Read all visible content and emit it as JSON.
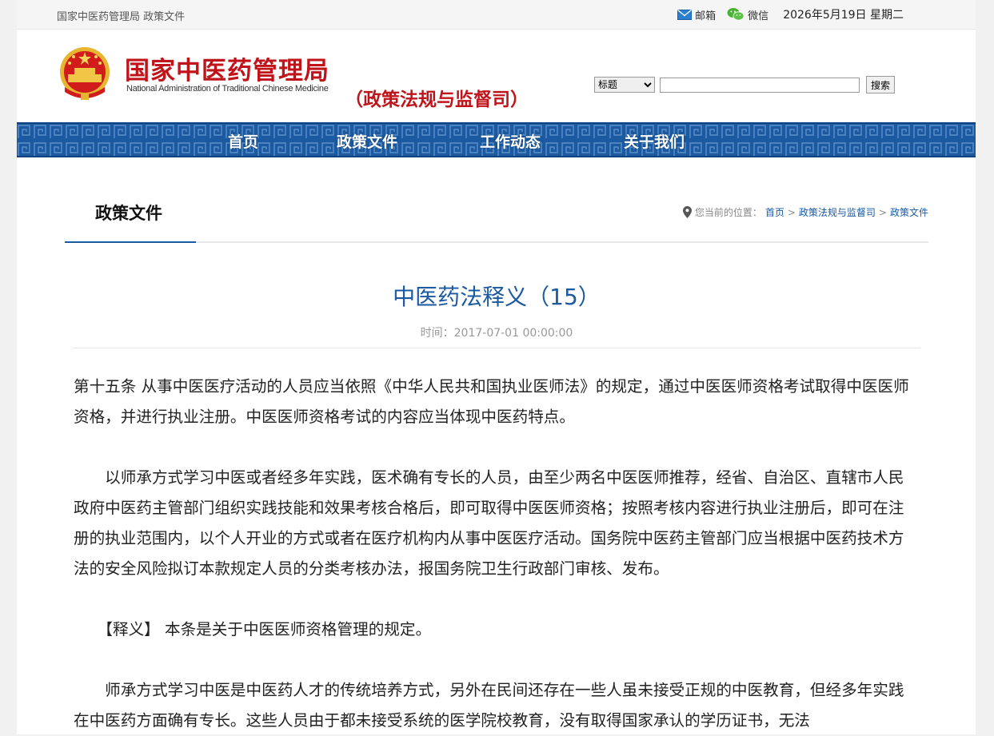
{
  "topbar": {
    "site": "国家中医药管理局 政策文件",
    "mail_label": "邮箱",
    "wechat_label": "微信",
    "date": "2026年5月19日 星期二"
  },
  "header": {
    "logo_cn": "国家中医药管理局",
    "logo_en": "National Administration of Traditional Chinese Medicine",
    "dept": "（政策法规与监督司）",
    "search_select": "标题",
    "search_value": "",
    "search_button": "搜索"
  },
  "nav": {
    "items": [
      {
        "label": "首页"
      },
      {
        "label": "政策文件"
      },
      {
        "label": "工作动态"
      },
      {
        "label": "关于我们"
      }
    ]
  },
  "content": {
    "tab_label": "政策文件",
    "location": {
      "prefix": "您当前的位置：",
      "crumb1": "首页",
      "crumb2": "政策法规与监督司",
      "crumb3": "政策文件",
      "sep": ">"
    },
    "title": "中医药法释义（15）",
    "time": "时间：2017-07-01 00:00:00",
    "paragraphs": [
      " 第十五条 从事中医医疗活动的人员应当依照《中华人民共和国执业医师法》的规定，通过中医医师资格考试取得中医医师资格，并进行执业注册。中医医师资格考试的内容应当体现中医药特点。",
      "　　以师承方式学习中医或者经多年实践，医术确有专长的人员，由至少两名中医医师推荐，经省、自治区、直辖市人民政府中医药主管部门组织实践技能和效果考核合格后，即可取得中医医师资格；按照考核内容进行执业注册后，即可在注册的执业范围内，以个人开业的方式或者在医疗机构内从事中医医疗活动。国务院中医药主管部门应当根据中医药技术方法的安全风险拟订本款规定人员的分类考核办法，报国务院卫生行政部门审核、发布。",
      "　　【释义】 本条是关于中医医师资格管理的规定。",
      "　　师承方式学习中医是中医药人才的传统培养方式，另外在民间还存在一些人虽未接受正规的中医教育，但经多年实践在中医药方面确有专长。这些人员由于都未接受系统的医学院校教育，没有取得国家承认的学历证书，无法"
    ]
  }
}
